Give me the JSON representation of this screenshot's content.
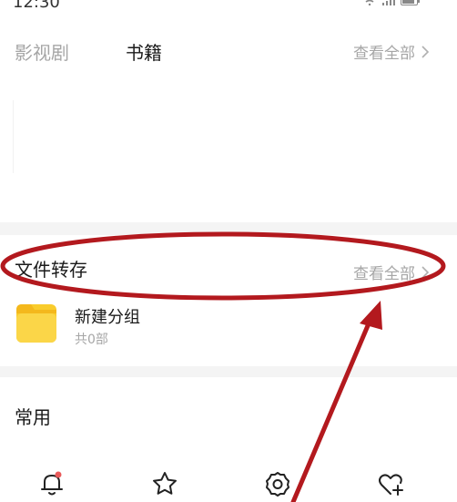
{
  "statusbar": {
    "time": "12:30"
  },
  "tabs": {
    "items": [
      {
        "label": "影视剧",
        "active": false
      },
      {
        "label": "书籍",
        "active": true
      }
    ],
    "view_all": "查看全部"
  },
  "file_transfer": {
    "title": "文件转存",
    "view_all": "查看全部",
    "folder": {
      "name": "新建分组",
      "count": "共0部"
    }
  },
  "common": {
    "title": "常用"
  },
  "bottom_nav": {
    "icons": [
      "bell-icon",
      "star-icon",
      "gear-icon",
      "heart-plus-icon"
    ]
  },
  "colors": {
    "annotation_red": "#b3191e",
    "folder_yellow": "#f9cc2c",
    "muted_text": "#a6a6a6",
    "notification_dot": "#e95a5a"
  }
}
